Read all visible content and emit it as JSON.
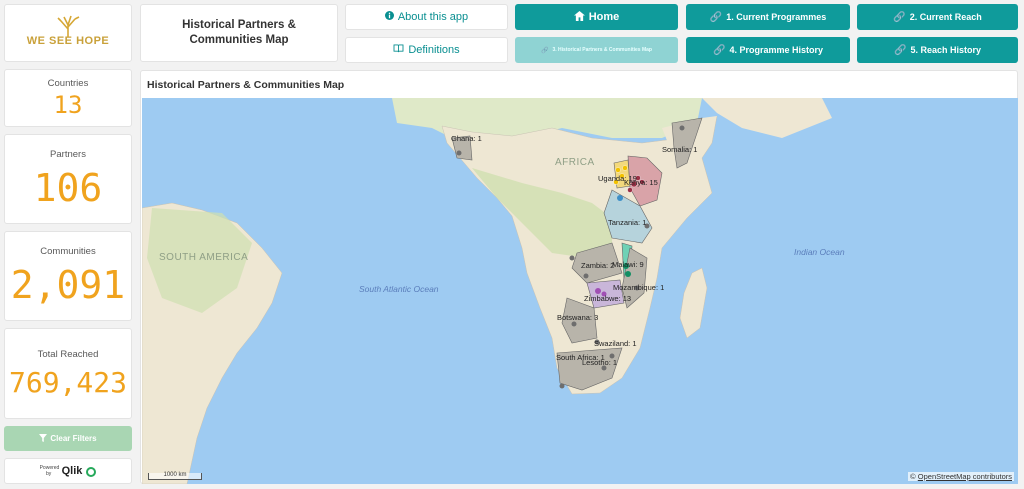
{
  "logo": {
    "text": "WE SEE HOPE"
  },
  "header": {
    "title": "Historical Partners & Communities Map",
    "about_label": "About this app",
    "definitions_label": "Definitions",
    "home_label": "Home",
    "nav": [
      {
        "label": "1. Current Programmes"
      },
      {
        "label": "2. Current Reach"
      },
      {
        "label": "3. Historical Partners & Communities Map"
      },
      {
        "label": "4. Programme History"
      },
      {
        "label": "5. Reach History"
      }
    ]
  },
  "kpis": [
    {
      "label": "Countries",
      "value": "13"
    },
    {
      "label": "Partners",
      "value": "106"
    },
    {
      "label": "Communities",
      "value": "2,091"
    },
    {
      "label": "Total Reached",
      "value": "769,423"
    }
  ],
  "clear_filters_label": "Clear Filters",
  "qlik": {
    "powered": "Powered by",
    "name": "Qlik"
  },
  "map": {
    "title": "Historical Partners & Communities Map",
    "continent_labels": {
      "africa": "AFRICA",
      "south_america": "SOUTH AMERICA"
    },
    "ocean_labels": {
      "atlantic": "South Atlantic Ocean",
      "indian": "Indian Ocean"
    },
    "country_labels": [
      "Ghana: 1",
      "Somalia: 1",
      "Uganda: 19",
      "Kenya: 15",
      "Tanzania: 1",
      "Zambia: 2",
      "Malawi: 9",
      "Mozambique: 1",
      "Zimbabwe: 13",
      "Botswana: 3",
      "Swaziland: 1",
      "South Africa: 1",
      "Lesotho: 1"
    ],
    "scale_label": "1000 km",
    "attribution_prefix": "©",
    "attribution_link": "OpenStreetMap contributors"
  },
  "colors": {
    "teal": "#0f9b9b",
    "teal_light": "#8fd3d3",
    "kpi_orange": "#f0a31e",
    "ocean": "#9ecbf2",
    "land": "#eee7d3"
  },
  "icons": {
    "about": "info-circle-icon",
    "definitions": "book-icon",
    "home": "home-icon",
    "nav": "link-icon",
    "clear": "filter-icon"
  }
}
